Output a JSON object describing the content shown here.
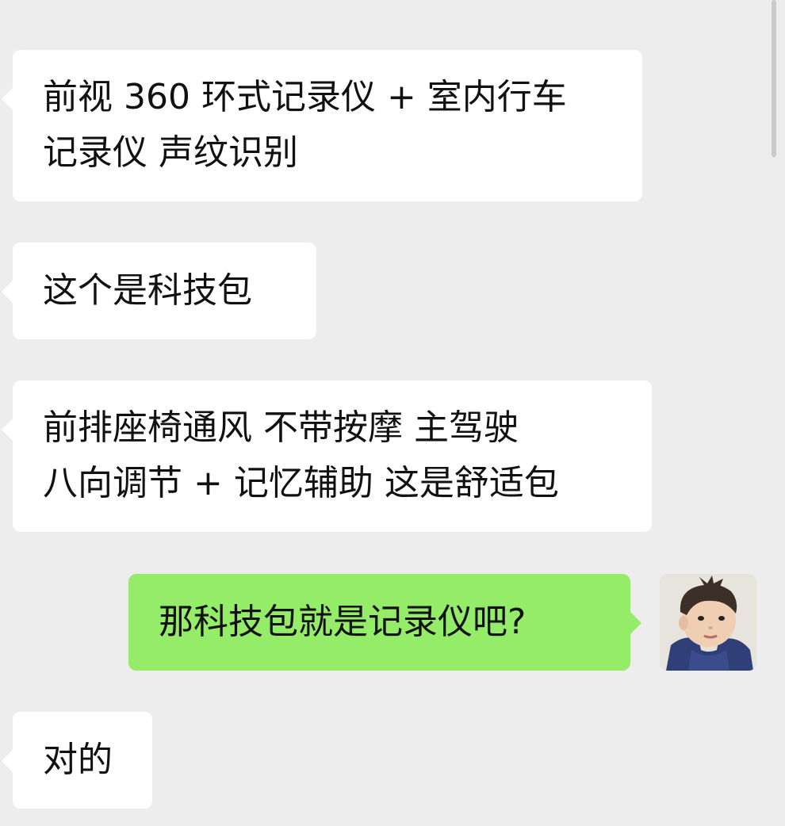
{
  "messages": [
    {
      "side": "left",
      "lines": [
        "前视 360 环式记录仪 + 室内行车",
        "记录仪 声纹识别"
      ]
    },
    {
      "side": "left",
      "lines": [
        "这个是科技包"
      ]
    },
    {
      "side": "left",
      "lines": [
        "前排座椅通风 不带按摩 主驾驶",
        "八向调节 + 记忆辅助 这是舒适包"
      ]
    },
    {
      "side": "right",
      "lines": [
        "那科技包就是记录仪吧?"
      ]
    },
    {
      "side": "left",
      "lines": [
        "对的"
      ]
    }
  ],
  "colors": {
    "background": "#ededed",
    "incoming_bubble": "#ffffff",
    "outgoing_bubble": "#95ec69"
  },
  "icons": {
    "avatar": "user-avatar-toddler-photo"
  }
}
